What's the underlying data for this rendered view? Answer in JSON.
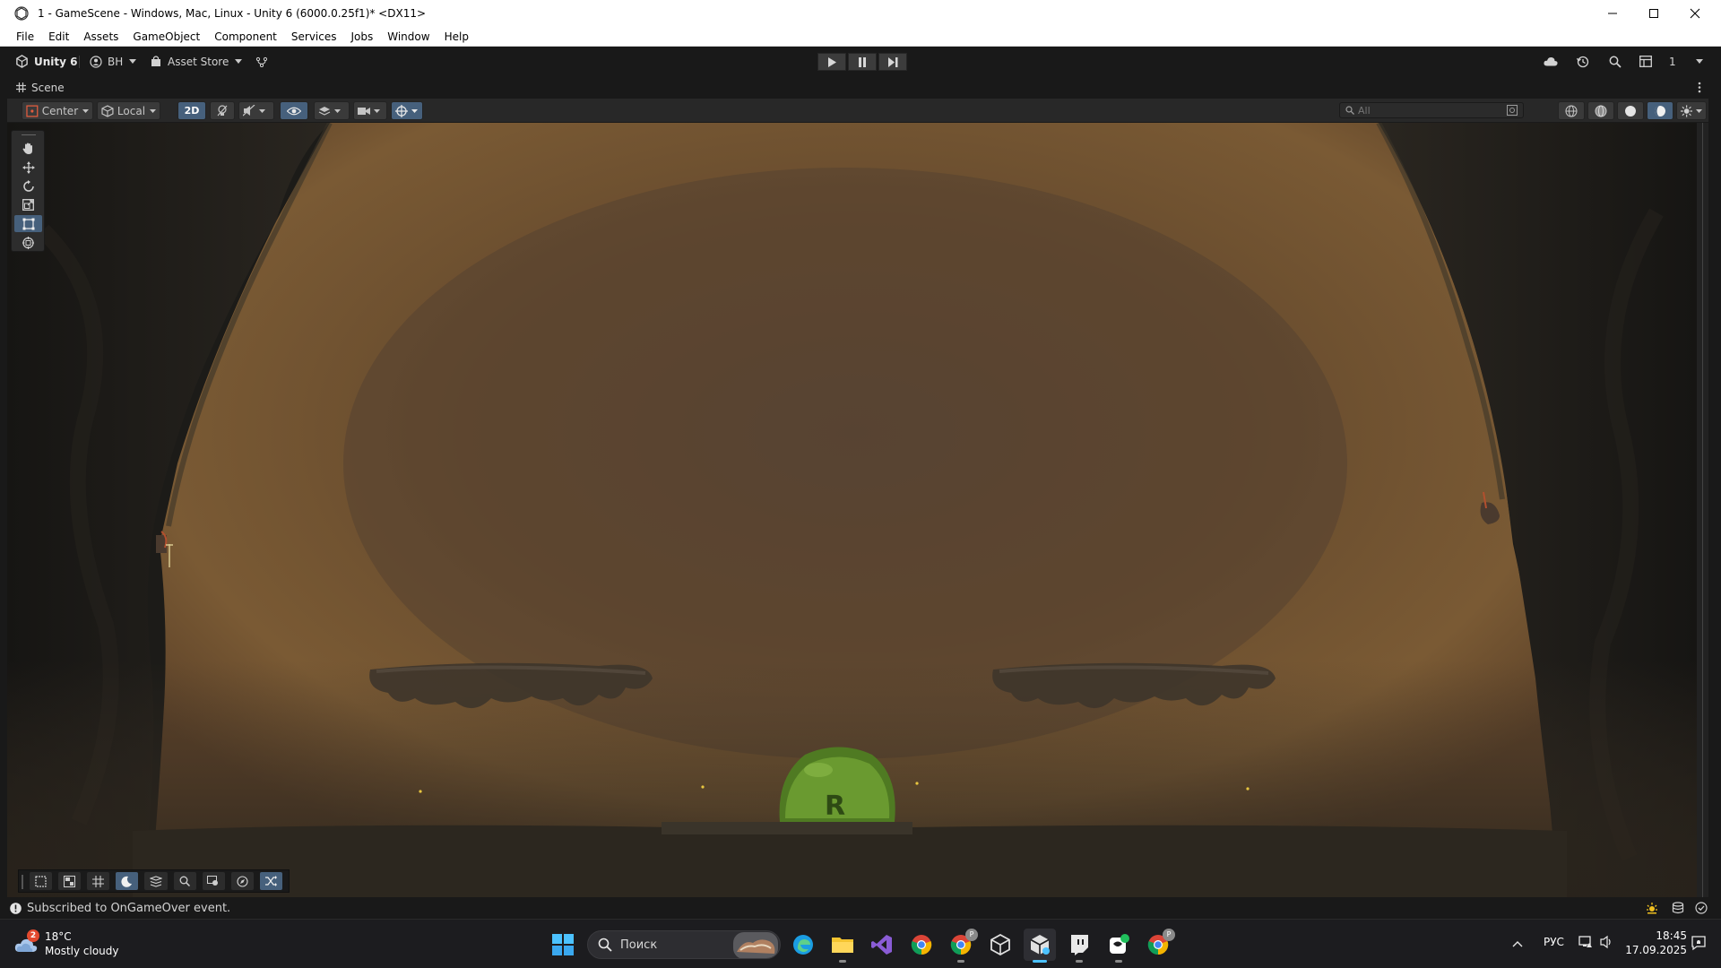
{
  "window": {
    "title": "1 - GameScene - Windows, Mac, Linux - Unity 6 (6000.0.25f1)* <DX11>"
  },
  "menu": [
    "File",
    "Edit",
    "Assets",
    "GameObject",
    "Component",
    "Services",
    "Jobs",
    "Window",
    "Help"
  ],
  "toolbar": {
    "unity_label": "Unity 6",
    "account_label": "BH",
    "asset_store_label": "Asset Store",
    "layout_count": "1"
  },
  "scene_tab": {
    "label": "Scene"
  },
  "scene_toolbar": {
    "pivot_label": "Center",
    "space_label": "Local",
    "mode_2d_label": "2D",
    "search_placeholder": "All"
  },
  "status": {
    "message": "Subscribed to OnGameOver event."
  },
  "taskbar": {
    "weather_temp": "18°C",
    "weather_desc": "Mostly cloudy",
    "weather_badge": "2",
    "search_label": "Поиск",
    "lang": "РУС",
    "time": "18:45",
    "date": "17.09.2025",
    "chrome_badge": "P"
  },
  "colors": {
    "accent_toolbar_on": "#46607c",
    "editor_bg": "#191919",
    "cave_glow": "#7a5a36",
    "slime_green": "#5f8c2a",
    "taskbar_accent": "#4cc2ff"
  }
}
